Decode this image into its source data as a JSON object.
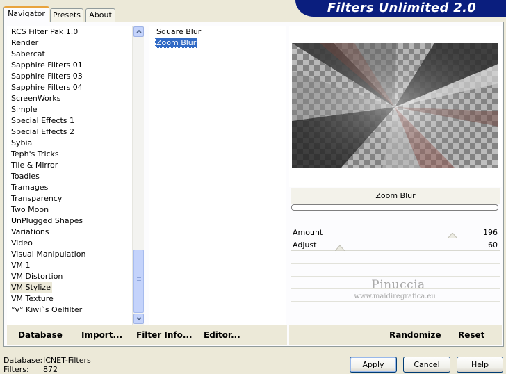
{
  "banner": {
    "title": "Filters Unlimited 2.0"
  },
  "tabs": [
    {
      "label": "Navigator",
      "active": true
    },
    {
      "label": "Presets",
      "active": false
    },
    {
      "label": "About",
      "active": false
    }
  ],
  "categories": [
    "RCS Filter Pak 1.0",
    "Render",
    "Sabercat",
    "Sapphire Filters 01",
    "Sapphire Filters 03",
    "Sapphire Filters 04",
    "ScreenWorks",
    "Simple",
    "Special Effects 1",
    "Special Effects 2",
    "Sybia",
    "Teph's Tricks",
    "Tile & Mirror",
    "Toadies",
    "Tramages",
    "Transparency",
    "Two Moon",
    "UnPlugged Shapes",
    "Variations",
    "Video",
    "Visual Manipulation",
    "VM 1",
    "VM Distortion",
    "VM Stylize",
    "VM Texture",
    "°v° Kiwi`s Oelfilter"
  ],
  "selected_category": "VM Stylize",
  "filters": [
    "Square Blur",
    "Zoom Blur"
  ],
  "selected_filter": "Zoom Blur",
  "preview": {
    "title": "Zoom Blur"
  },
  "params": [
    {
      "label": "Amount",
      "value": "196",
      "level": 0.77
    },
    {
      "label": "Adjust",
      "value": "60",
      "level": 0.235
    }
  ],
  "watermark": {
    "name": "Pinuccia",
    "site": "www.maidiregrafica.eu"
  },
  "toolbar": {
    "database": {
      "pre": "",
      "ul": "D",
      "post": "atabase"
    },
    "import": {
      "pre": "",
      "ul": "I",
      "post": "mport..."
    },
    "filter_info": {
      "pre": "Filter ",
      "ul": "I",
      "post": "nfo..."
    },
    "editor": {
      "pre": "",
      "ul": "E",
      "post": "ditor..."
    },
    "randomize": "Randomize",
    "reset": "Reset"
  },
  "status": {
    "database_label": "Database:",
    "database_value": "ICNET-Filters",
    "filters_label": "Filters:",
    "filters_value": "872"
  },
  "buttons": {
    "apply": "Apply",
    "cancel": "Cancel",
    "help": "Help"
  },
  "colors": {
    "banner": "#0a1e7e",
    "selection": "#316ac5",
    "tab_accent": "#e8a33c"
  }
}
